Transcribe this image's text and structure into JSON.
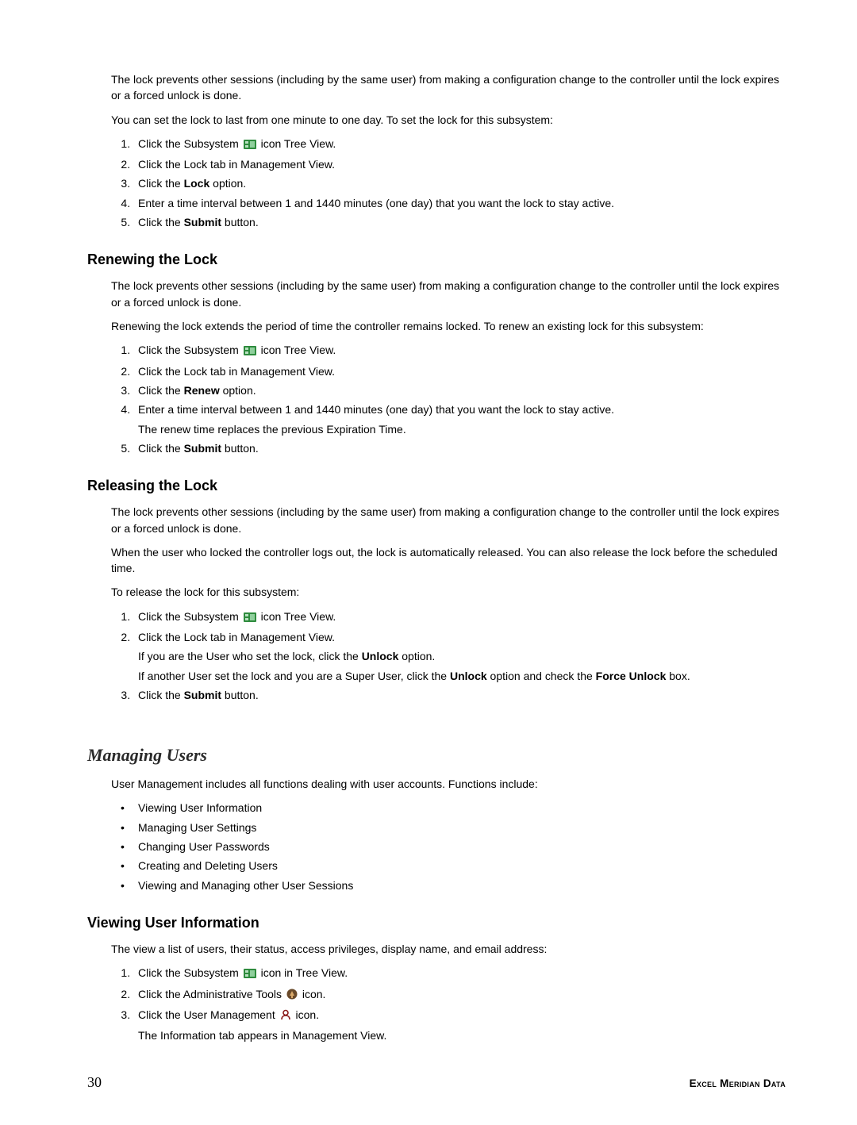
{
  "intro": {
    "p1": "The lock prevents other sessions (including by the same user) from making a configuration change to the controller until the lock expires or a forced unlock is done.",
    "p2": "You can set the lock to last from one minute to one day. To set the lock for this subsystem:"
  },
  "intro_steps": {
    "s1a": "Click the Subsystem ",
    "s1b": " icon Tree View.",
    "s2": "Click the Lock tab in Management View.",
    "s3a": "Click the ",
    "s3bold": "Lock",
    "s3b": " option.",
    "s4": "Enter a time interval between 1 and 1440 minutes (one day) that you want the lock to stay active.",
    "s5a": "Click the ",
    "s5bold": "Submit",
    "s5b": " button."
  },
  "renew": {
    "heading": "Renewing the Lock",
    "p1": "The lock prevents other sessions (including by the same user) from making a configuration change to the controller until the lock expires or a forced unlock is done.",
    "p2": "Renewing the lock extends the period of time the controller remains locked. To renew an existing lock for this subsystem:",
    "s1a": "Click the Subsystem ",
    "s1b": " icon Tree View.",
    "s2": "Click the Lock tab in Management View.",
    "s3a": "Click the ",
    "s3bold": "Renew",
    "s3b": " option.",
    "s4": "Enter a time interval between 1 and 1440 minutes (one day) that you want the lock to stay active.",
    "s4note": "The renew time replaces the previous Expiration Time.",
    "s5a": "Click the ",
    "s5bold": "Submit",
    "s5b": " button."
  },
  "release": {
    "heading": "Releasing the Lock",
    "p1": "The lock prevents other sessions (including by the same user) from making a configuration change to the controller until the lock expires or a forced unlock is done.",
    "p2": "When the user who locked the controller logs out, the lock is automatically released. You can also release the lock before the scheduled time.",
    "p3": "To release the lock for this subsystem:",
    "s1a": "Click the Subsystem ",
    "s1b": " icon Tree View.",
    "s2": "Click the Lock tab in Management View.",
    "s2note1a": "If you are the User who set the lock, click the ",
    "s2note1bold": "Unlock",
    "s2note1b": " option.",
    "s2note2a": "If another User set the lock and you are a Super User, click the ",
    "s2note2bold1": "Unlock",
    "s2note2mid": " option and check the ",
    "s2note2bold2": "Force Unlock",
    "s2note2b": " box.",
    "s3a": "Click the ",
    "s3bold": "Submit",
    "s3b": " button."
  },
  "managing": {
    "heading": "Managing Users",
    "p1": "User Management includes all functions dealing with user accounts. Functions include:",
    "bullets": [
      "Viewing User Information",
      "Managing User Settings",
      "Changing User Passwords",
      "Creating and Deleting Users",
      "Viewing and Managing other User Sessions"
    ]
  },
  "viewing": {
    "heading": "Viewing User Information",
    "p1": "The view a list of users, their status, access privileges, display name, and email address:",
    "s1a": "Click the Subsystem ",
    "s1b": " icon in Tree View.",
    "s2a": "Click the Administrative Tools ",
    "s2b": " icon.",
    "s3a": "Click the User Management ",
    "s3b": " icon.",
    "s3note": "The Information tab appears in Management View."
  },
  "footer": {
    "page": "30",
    "brand": "Excel Meridian Data"
  }
}
